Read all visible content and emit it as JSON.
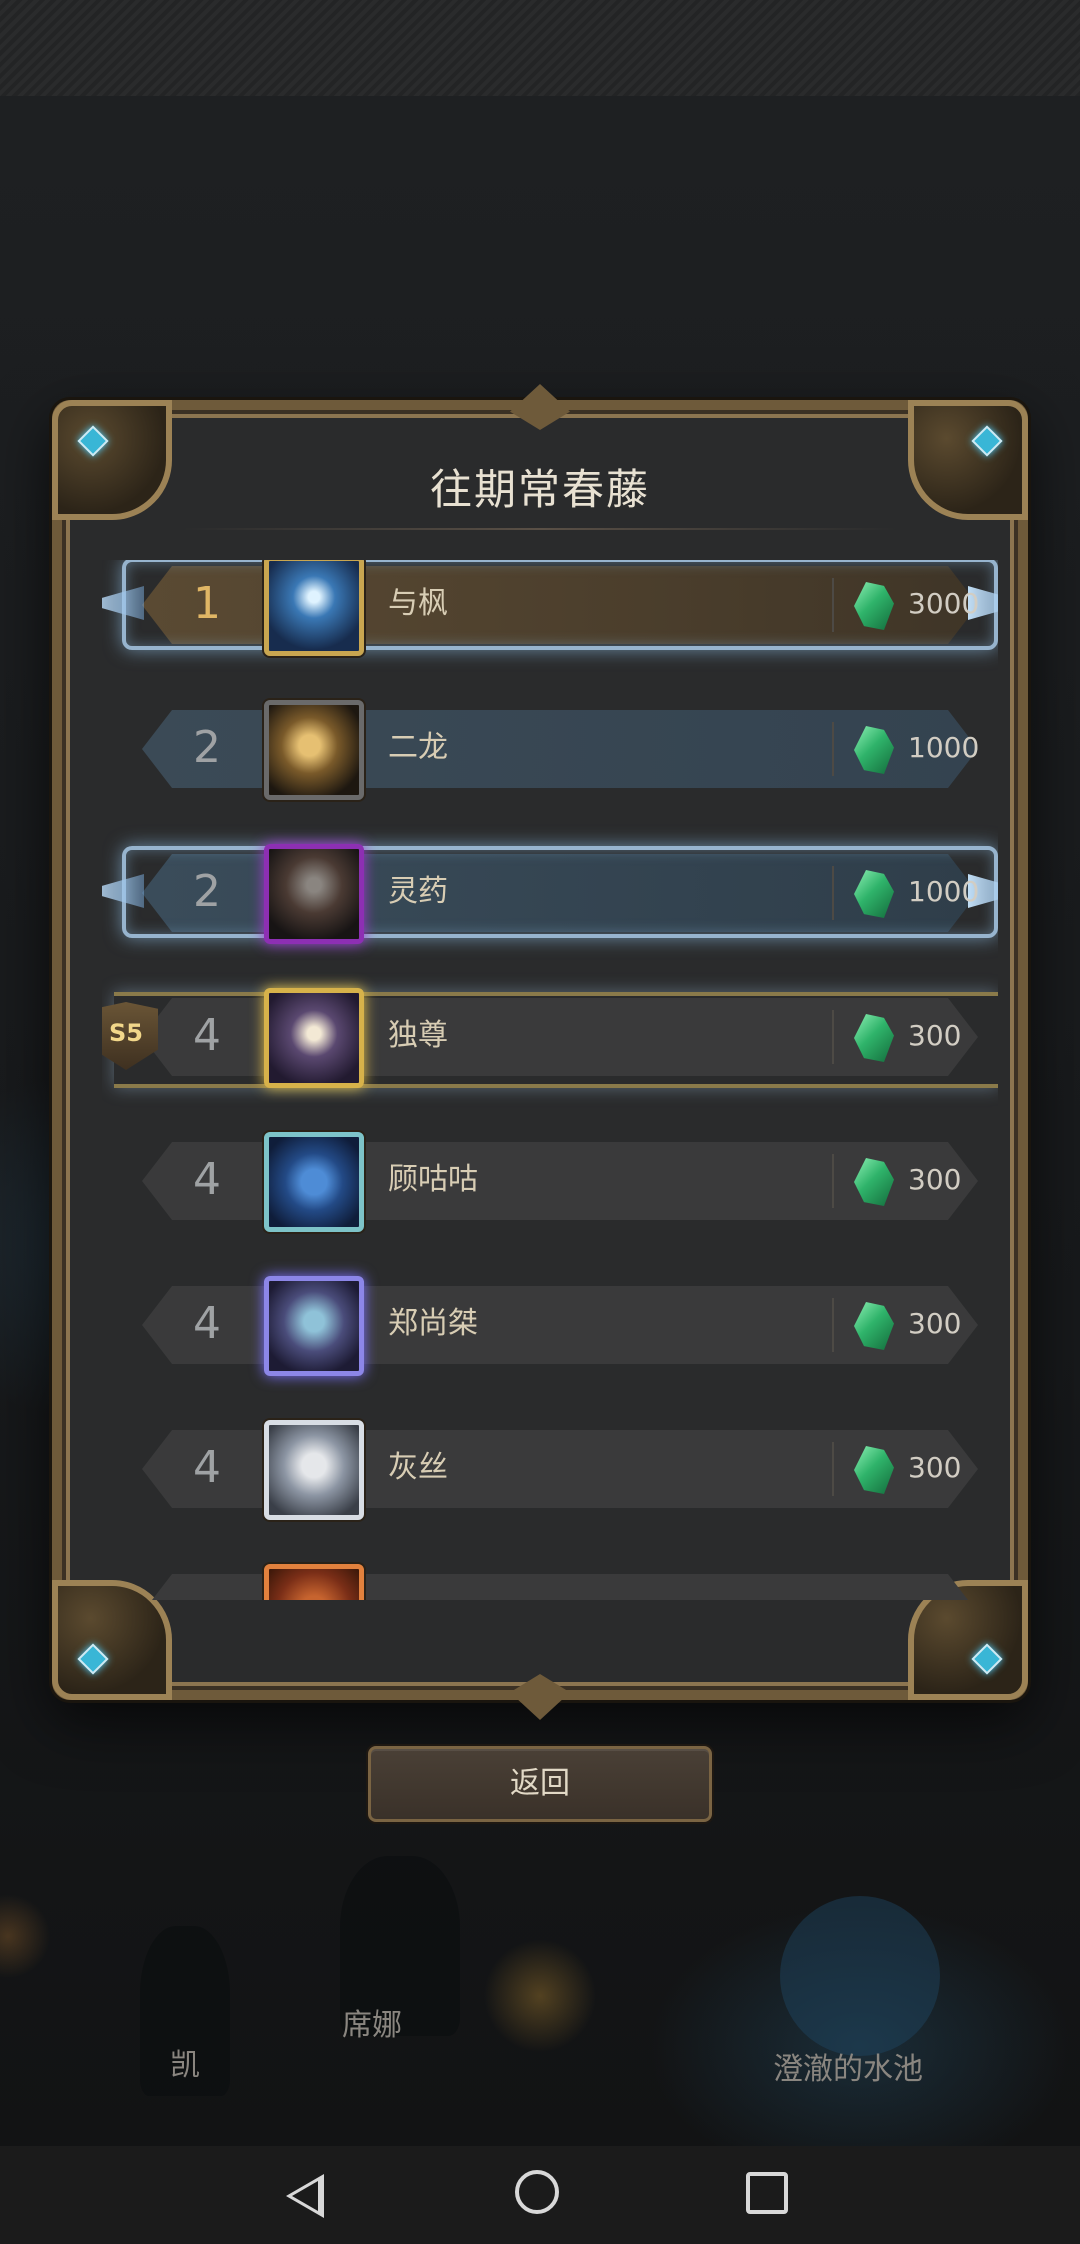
{
  "dialog": {
    "title": "往期常春藤",
    "back_button": "返回"
  },
  "leaderboard": {
    "rows": [
      {
        "rank": "1",
        "name": "与枫",
        "score": "3000",
        "style": "gold-ice"
      },
      {
        "rank": "2",
        "name": "二龙",
        "score": "1000",
        "style": "blue"
      },
      {
        "rank": "2",
        "name": "灵药",
        "score": "1000",
        "style": "ice"
      },
      {
        "rank": "4",
        "name": "独尊",
        "score": "300",
        "style": "vine",
        "season_badge": "S5"
      },
      {
        "rank": "4",
        "name": "顾咕咕",
        "score": "300",
        "style": "plain"
      },
      {
        "rank": "4",
        "name": "郑尚桀",
        "score": "300",
        "style": "plain"
      },
      {
        "rank": "4",
        "name": "灰丝",
        "score": "300",
        "style": "plain"
      }
    ],
    "reward_icon": "green-crystal-icon"
  },
  "background_labels": {
    "left_1": "凯",
    "left_2": "席娜",
    "right": "澄澈的水池"
  },
  "system_nav": {
    "back_icon": "triangle-back-icon",
    "home_icon": "circle-home-icon",
    "recent_icon": "square-recents-icon"
  },
  "colors": {
    "accent_gold": "#e0b665",
    "reward_green": "#2fb36a",
    "frame_bronze": "#8c7550"
  }
}
